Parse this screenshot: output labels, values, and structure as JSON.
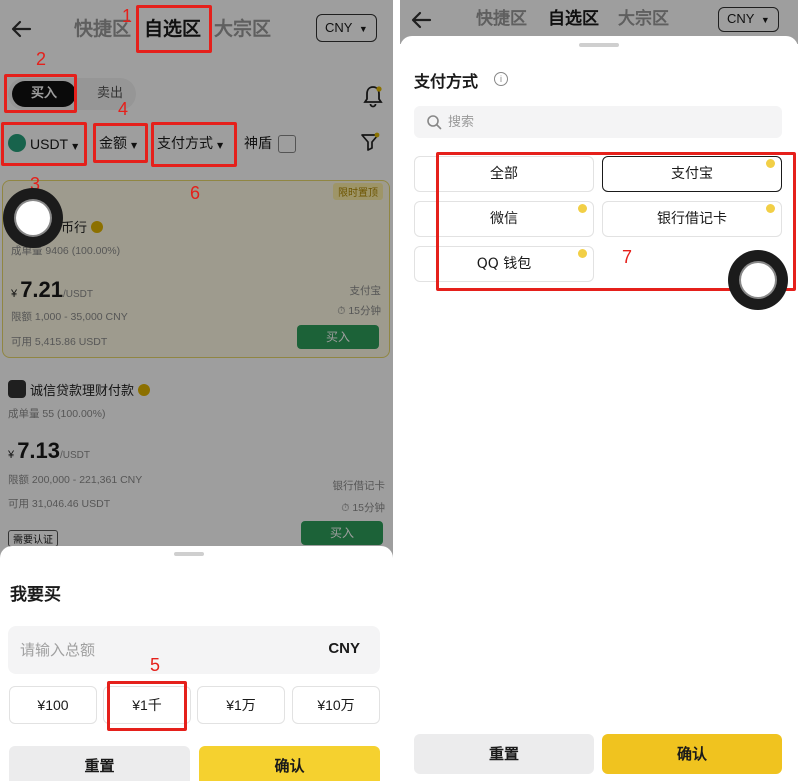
{
  "header": {
    "tabs": [
      {
        "label": "快捷区"
      },
      {
        "label": "自选区"
      },
      {
        "label": "大宗区"
      }
    ],
    "currency": "CNY"
  },
  "trade_toggle": {
    "buy": "买入",
    "sell": "卖出"
  },
  "filters": {
    "coin": "USDT",
    "amount": "金额",
    "payment": "支付方式",
    "shield": "神盾"
  },
  "offers": [
    {
      "merchant": "币行",
      "promo": "限时置顶",
      "stats": "成单量 9406 (100.00%)",
      "currency_symbol": "¥",
      "price": "7.21",
      "unit": "/USDT",
      "limit": "限额 1,000 - 35,000 CNY",
      "available": "可用 5,415.86 USDT",
      "pay_method": "支付宝",
      "time": "15分钟",
      "action": "买入"
    },
    {
      "merchant": "诚信贷款理财付款",
      "stats": "成单量 55 (100.00%)",
      "currency_symbol": "¥",
      "price": "7.13",
      "unit": "/USDT",
      "limit": "限额 200,000 - 221,361 CNY",
      "available": "可用 31,046.46 USDT",
      "pay_method": "银行借记卡",
      "time": "15分钟",
      "action": "买入",
      "tag": "需要认证"
    }
  ],
  "buy_sheet": {
    "title": "我要买",
    "placeholder": "请输入总额",
    "currency": "CNY",
    "quick_amounts": [
      "¥100",
      "¥1千",
      "¥1万",
      "¥10万"
    ],
    "reset": "重置",
    "confirm": "确认"
  },
  "payment_sheet": {
    "title": "支付方式",
    "search_placeholder": "搜索",
    "options": [
      "全部",
      "支付宝",
      "微信",
      "银行借记卡",
      "QQ 钱包"
    ],
    "selected": "支付宝",
    "reset": "重置",
    "confirm": "确认"
  },
  "annotations": [
    "1",
    "2",
    "3",
    "4",
    "5",
    "6",
    "7"
  ],
  "colors": {
    "annotation": "#e5201b",
    "buy_green": "#2e9e5b",
    "confirm_yellow": "#f5d12f"
  }
}
